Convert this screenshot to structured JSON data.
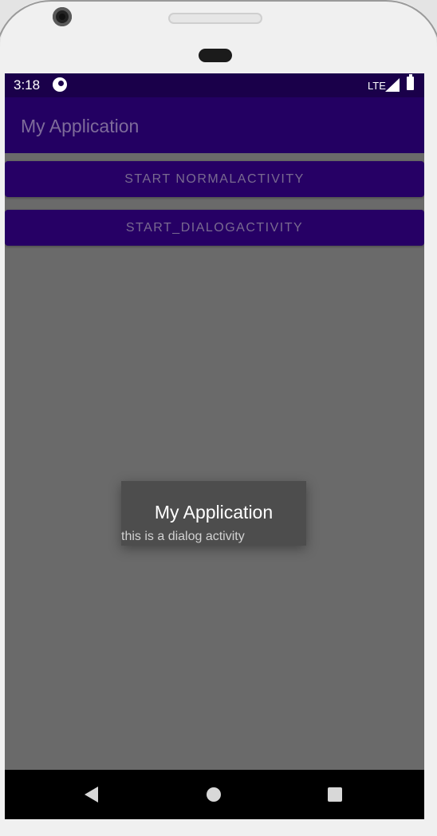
{
  "status_bar": {
    "time": "3:18",
    "network": "LTE",
    "icons": [
      "app-notification-icon",
      "signal-icon",
      "battery-icon"
    ]
  },
  "app_bar": {
    "title": "My Application"
  },
  "buttons": {
    "start_normal": "START NORMALACTIVITY",
    "start_dialog": "START_DIALOGACTIVITY"
  },
  "dialog": {
    "title": "My Application",
    "message": "this is a dialog activity"
  },
  "nav_bar": {
    "icons": [
      "back-icon",
      "home-icon",
      "recents-icon"
    ]
  },
  "colors": {
    "status_bar": "#1a004a",
    "app_bar": "#230062",
    "button": "#260065",
    "scrim_background": "#6a6a6a",
    "dialog_background": "#4d4d4d"
  }
}
